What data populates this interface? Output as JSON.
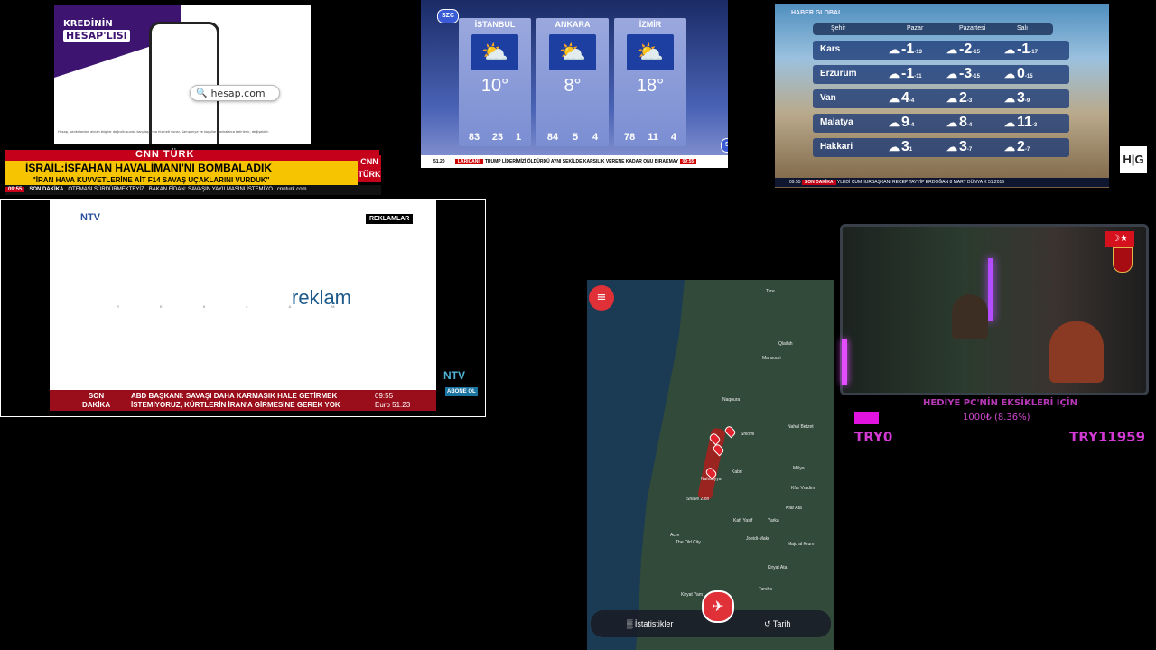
{
  "cnn_panel": {
    "ad_banner_line1": "KREDİNİN",
    "ad_banner_line2": "HESAP'LISI",
    "ad_search": "hesap.com",
    "ad_disclaimer": "Hesap, bankalardan alınan bilgiler doğrultusunda karşılaştırma hizmeti sunar. Kampanya ve koşullar bankalarca belirlenir, değişebilir.",
    "channel": "CNN TÜRK",
    "headline": "İSRAİL:İSFAHAN HAVALİMANI'NI BOMBALADIK",
    "subheadline": "\"İRAN HAVA KUVVETLERİNE AİT F14 SAVAŞ UÇAKLARINI VURDUK\"",
    "logo": "CNN TÜRK",
    "ticker_time": "09:55",
    "ticker_label": "SON DAKİKA",
    "ticker_text1": "OTEMASI SÜRDÜRMEKTEYİZ",
    "ticker_text2": "BAKAN FİDAN: SAVAŞIN YAYILMASINI İSTEMİYO",
    "site": "cnnturk.com"
  },
  "szc_panel": {
    "logo": "SZC",
    "cities": [
      {
        "name": "İSTANBUL",
        "temp": "10°",
        "icon": "partly-cloudy-icon",
        "stats": [
          "83",
          "23",
          "1"
        ]
      },
      {
        "name": "ANKARA",
        "temp": "8°",
        "icon": "partly-cloudy-icon",
        "stats": [
          "84",
          "5",
          "4"
        ]
      },
      {
        "name": "İZMİR",
        "temp": "18°",
        "icon": "partly-cloudy-icon",
        "stats": [
          "78",
          "11",
          "4"
        ]
      }
    ],
    "ticker_price": "51.20",
    "ticker_label": "LARİCANİ:",
    "ticker_text": "TRUMP LİDERİMİZİ ÖLDÜRDÜ AYNI ŞEKİLDE KARŞILIK VERENE KADAR ONU BIRAKMAY",
    "ticker_time": "09:55"
  },
  "haber_panel": {
    "brand": "HABER GLOBAL",
    "headers": [
      "Şehir",
      "Pazar",
      "Pazartesi",
      "Salı"
    ],
    "rows": [
      {
        "city": "Kars",
        "days": [
          [
            "-1",
            "-13"
          ],
          [
            "-2",
            "-15"
          ],
          [
            "-1",
            "-17"
          ]
        ]
      },
      {
        "city": "Erzurum",
        "days": [
          [
            "-1",
            "-11"
          ],
          [
            "-3",
            "-15"
          ],
          [
            "0",
            "-15"
          ]
        ]
      },
      {
        "city": "Van",
        "days": [
          [
            "4",
            "-4"
          ],
          [
            "2",
            "-3"
          ],
          [
            "3",
            "-9"
          ]
        ]
      },
      {
        "city": "Malatya",
        "days": [
          [
            "9",
            "-4"
          ],
          [
            "8",
            "-4"
          ],
          [
            "11",
            "-3"
          ]
        ]
      },
      {
        "city": "Hakkari",
        "days": [
          [
            "3",
            "1"
          ],
          [
            "3",
            "-7"
          ],
          [
            "2",
            "-7"
          ]
        ]
      }
    ],
    "logo": "H|G",
    "ticker_time": "09:55",
    "ticker_label": "SON DAKİKA",
    "ticker_text": "YLEDİ  CUMHURBAŞKANI RECEP TAYYİP ERDOĞAN 8 MART DÜNYA K",
    "ticker_price": "51.2016"
  },
  "ntv_panel": {
    "logo": "NTV",
    "badge": "REKLAMLAR",
    "spaced_text": "R E K L A M",
    "main_text": "reklam",
    "ticker_label1": "SON",
    "ticker_label2": "DAKİKA",
    "ticker_text1": "ABD BAŞKANI: SAVAŞI DAHA KARMAŞIK HALE GETİRMEK",
    "ticker_text2": "İSTEMİYORUZ, KÜRTLERİN İRAN'A GİRMESİNE GEREK YOK",
    "ticker_time": "09:55",
    "ticker_price": "Euro  51.23",
    "logo2": "NTV",
    "subscribe": "ABONE OL"
  },
  "map_panel": {
    "towns": [
      "Tyre",
      "Qlailah",
      "Mansouri",
      "Naqoura",
      "Shlomi",
      "Nahal Betzet",
      "Kabri",
      "Nahariyya",
      "Shave Zion",
      "Yarka",
      "Kafr Yasif",
      "Jdeidi-Makr",
      "Kfar Vradim",
      "Majd al Krum",
      "Tarsha",
      "Kiryat Yam",
      "Acre",
      "The Old City",
      "Kiryat Ata",
      "Kfar Ata",
      "M'ilya"
    ],
    "nav_stats": "İstatistikler",
    "nav_history": "Tarih"
  },
  "donation": {
    "title": "HEDİYE PC'NİN EKSİKLERİ İÇİN",
    "amount": "1000₺ (8.36%)",
    "min": "TRY0",
    "max": "TRY11959",
    "progress_fraction": 0.0836,
    "bar_color": "#e013e0"
  }
}
